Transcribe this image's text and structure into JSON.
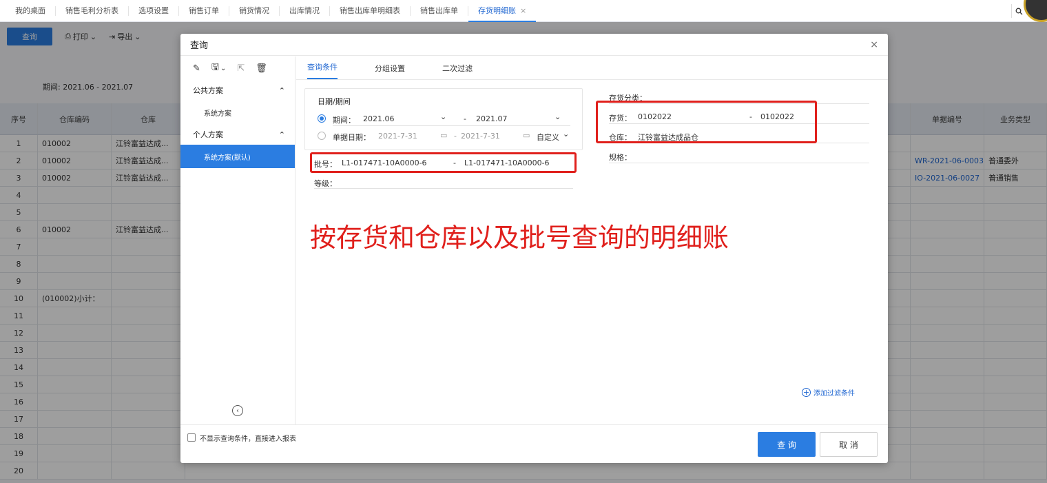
{
  "tabs": [
    "我的桌面",
    "销售毛利分析表",
    "选项设置",
    "销售订单",
    "销货情况",
    "出库情况",
    "销售出库单明细表",
    "销售出库单"
  ],
  "active_tab": "存货明细账",
  "toolbar": {
    "query": "查询",
    "print": "打印",
    "export": "导出"
  },
  "period_text": "期间: 2021.06 - 2021.07",
  "grid": {
    "headers": {
      "no": "序号",
      "wh_code": "仓库编码",
      "wh": "仓库",
      "bill": "单据编号",
      "type": "业务类型"
    },
    "rows": [
      {
        "no": "1",
        "code": "010002",
        "wh": "江铃富益达成...",
        "bill": "",
        "type": ""
      },
      {
        "no": "2",
        "code": "010002",
        "wh": "江铃富益达成...",
        "bill": "WR-2021-06-0003",
        "type": "普通委外"
      },
      {
        "no": "3",
        "code": "010002",
        "wh": "江铃富益达成...",
        "bill": "IO-2021-06-0027",
        "type": "普通销售"
      },
      {
        "no": "4",
        "code": "",
        "wh": "",
        "bill": "",
        "type": ""
      },
      {
        "no": "5",
        "code": "",
        "wh": "",
        "bill": "",
        "type": ""
      },
      {
        "no": "6",
        "code": "010002",
        "wh": "江铃富益达成...",
        "bill": "",
        "type": ""
      },
      {
        "no": "7",
        "code": "",
        "wh": "",
        "bill": "",
        "type": ""
      },
      {
        "no": "8",
        "code": "",
        "wh": "",
        "bill": "",
        "type": ""
      },
      {
        "no": "9",
        "code": "",
        "wh": "",
        "bill": "",
        "type": ""
      },
      {
        "no": "10",
        "code": "(010002)小计：",
        "wh": "",
        "bill": "",
        "type": ""
      },
      {
        "no": "11",
        "code": "",
        "wh": "",
        "bill": "",
        "type": ""
      },
      {
        "no": "12",
        "code": "",
        "wh": "",
        "bill": "",
        "type": ""
      },
      {
        "no": "13",
        "code": "",
        "wh": "",
        "bill": "",
        "type": ""
      },
      {
        "no": "14",
        "code": "",
        "wh": "",
        "bill": "",
        "type": ""
      },
      {
        "no": "15",
        "code": "",
        "wh": "",
        "bill": "",
        "type": ""
      },
      {
        "no": "16",
        "code": "",
        "wh": "",
        "bill": "",
        "type": ""
      },
      {
        "no": "17",
        "code": "",
        "wh": "",
        "bill": "",
        "type": ""
      },
      {
        "no": "18",
        "code": "",
        "wh": "",
        "bill": "",
        "type": ""
      },
      {
        "no": "19",
        "code": "",
        "wh": "",
        "bill": "",
        "type": ""
      },
      {
        "no": "20",
        "code": "",
        "wh": "",
        "bill": "",
        "type": ""
      }
    ]
  },
  "dialog": {
    "title": "查询",
    "close": "×",
    "public_group": "公共方案",
    "public_scheme": "系统方案",
    "personal_group": "个人方案",
    "personal_scheme": "系统方案(默认)",
    "tabs": [
      "查询条件",
      "分组设置",
      "二次过滤"
    ],
    "date_header": "日期/期间",
    "period_label": "期间：",
    "period_from": "2021.06",
    "period_to": "2021.07",
    "billdate_label": "单据日期：",
    "billdate_from": "2021-7-31",
    "billdate_to": "2021-7-31",
    "custom": "自定义",
    "batch_label": "批号：",
    "batch_from": "L1-017471-10A0000-6",
    "batch_to": "L1-017471-10A0000-6",
    "grade_label": "等级：",
    "inv_class_label": "存货分类：",
    "inv_label": "存货：",
    "inv_from": "0102022",
    "inv_to": "0102022",
    "wh_label": "仓库：",
    "wh_value": "江铃富益达成品仓",
    "spec_label": "规格：",
    "add_filter": "添加过滤条件",
    "skip_text": "不显示查询条件，直接进入报表",
    "ok": "查 询",
    "cancel": "取 消"
  },
  "annotation": "按存货和仓库以及批号查询的明细账"
}
